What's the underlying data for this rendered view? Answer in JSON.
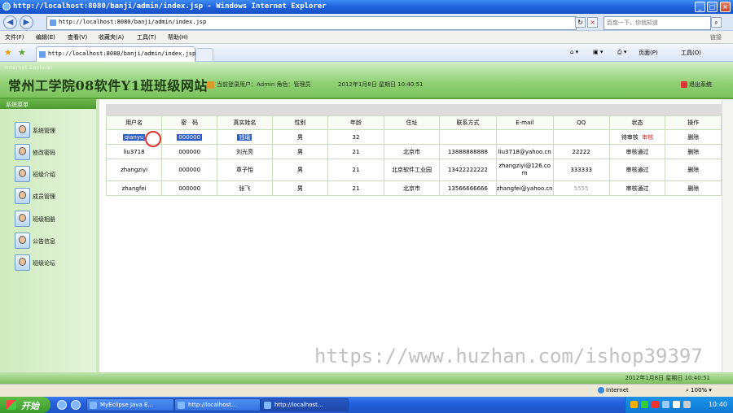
{
  "window": {
    "title": "http://localhost:8080/banji/admin/index.jsp - Windows Internet Explorer",
    "min": "_",
    "max": "□",
    "close": "×"
  },
  "address_bar": {
    "url": "http://localhost:8080/banji/admin/index.jsp",
    "search_placeholder": "百度一下，你就知道"
  },
  "menu": {
    "items": [
      "文件(F)",
      "编辑(E)",
      "查看(V)",
      "收藏夹(A)",
      "工具(T)",
      "帮助(H)"
    ],
    "links": "链接"
  },
  "tab": {
    "title": "http://localhost:8080/banji/admin/index.jsp"
  },
  "commands": {
    "page": "页面(P)",
    "tools": "工具(O)"
  },
  "header": {
    "small_text": "Internet Explorer",
    "site_title": "常州工学院08软件Y1班班级网站",
    "user_info": "当前登录用户：Admin 角色：管理员",
    "datetime": "2012年1月8日  星期日  10:40:51",
    "logout": "退出系统"
  },
  "sidebar": {
    "header": "系统菜单",
    "items": [
      {
        "label": "系统管理"
      },
      {
        "label": "修改密码"
      },
      {
        "label": "班级介绍"
      },
      {
        "label": "成员管理"
      },
      {
        "label": "班级相册"
      },
      {
        "label": "公告信息"
      },
      {
        "label": "班级论坛"
      }
    ]
  },
  "table": {
    "columns": [
      "用户名",
      "密　码",
      "真实姓名",
      "性别",
      "年龄",
      "住址",
      "联系方式",
      "E-mail",
      "QQ",
      "状态",
      "操作"
    ],
    "rows": [
      {
        "username": "qianyu",
        "password": "000000",
        "realname": "钱瑜",
        "gender": "男",
        "age": "32",
        "address": "",
        "phone": "",
        "email": "",
        "qq": "",
        "status": "待审核",
        "action_approve": "审核",
        "action": "删除"
      },
      {
        "username": "liu3718",
        "password": "000000",
        "realname": "刘光亮",
        "gender": "男",
        "age": "21",
        "address": "北京市",
        "phone": "13888888888",
        "email": "liu3718@yahoo.cn",
        "qq": "22222",
        "status": "审核通过",
        "action": "删除"
      },
      {
        "username": "zhangziyi",
        "password": "000000",
        "realname": "章子怡",
        "gender": "男",
        "age": "21",
        "address": "北京软件工业园",
        "phone": "13422222222",
        "email": "zhangziyi@126.com",
        "qq": "333333",
        "status": "审核通过",
        "action": "删除"
      },
      {
        "username": "zhangfei",
        "password": "000000",
        "realname": "张飞",
        "gender": "男",
        "age": "21",
        "address": "北京市",
        "phone": "13566666666",
        "email": "zhangfei@yahoo.cn",
        "qq": "5555",
        "status": "审核通过",
        "action": "删除"
      }
    ]
  },
  "watermark": "https://www.huzhan.com/ishop39397",
  "page_footer": "2012年1月8日  星期日  10:40:51",
  "statusbar": {
    "zone": "Internet",
    "zoom": "100%"
  },
  "taskbar": {
    "start": "开始",
    "tasks": [
      "MyEclipse Java E...",
      "http://localhost...",
      "http://localhost..."
    ],
    "clock": "10:40"
  }
}
